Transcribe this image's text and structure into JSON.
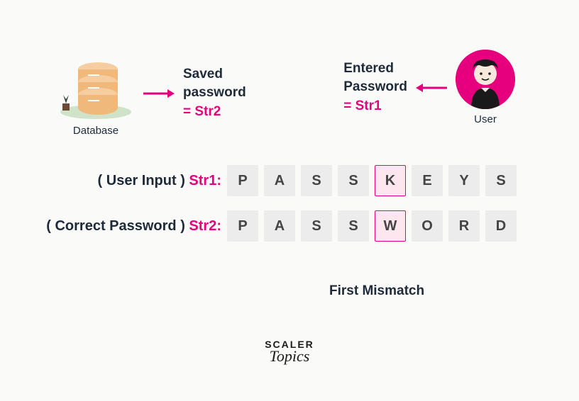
{
  "top": {
    "database_label": "Database",
    "saved_line1": "Saved",
    "saved_line2": "password",
    "saved_eq": "= Str2",
    "entered_line1": "Entered",
    "entered_line2": "Password",
    "entered_eq": "= Str1",
    "user_label": "User"
  },
  "rows": {
    "str1_prefix": "( User Input ) ",
    "str1_name": "Str1:",
    "str2_prefix": "( Correct Password ) ",
    "str2_name": "Str2:",
    "str1_cells": [
      "P",
      "A",
      "S",
      "S",
      "K",
      "E",
      "Y",
      "S"
    ],
    "str2_cells": [
      "P",
      "A",
      "S",
      "S",
      "W",
      "O",
      "R",
      "D"
    ],
    "mismatch_index": 4,
    "mismatch_label": "First Mismatch"
  },
  "logo": {
    "top": "SCALER",
    "bottom": "Topics"
  },
  "colors": {
    "pink": "#e6007e",
    "cell_bg": "#ececec",
    "db_body": "#f0b87a",
    "db_top": "#f5cda0",
    "ground": "#cfe3c9"
  }
}
